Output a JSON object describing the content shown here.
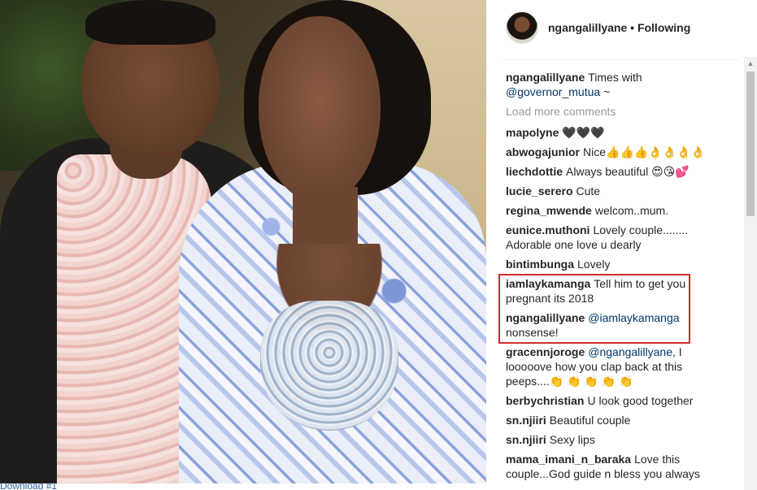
{
  "photo": {
    "caption": "Download #1"
  },
  "header": {
    "username": "ngangalillyane",
    "separator": "•",
    "follow_state": "Following"
  },
  "caption": {
    "username": "ngangalillyane",
    "text_before": "Times with",
    "mention": "@governor_mutua",
    "text_after": "~"
  },
  "load_more": "Load more comments",
  "comments": [
    {
      "username": "mapolyne",
      "text": "🖤🖤🖤"
    },
    {
      "username": "abwogajunior",
      "text": "Nice👍👍👍👌👌👌👌"
    },
    {
      "username": "liechdottie",
      "text": "Always beautiful 😍😘💕"
    },
    {
      "username": "lucie_serero",
      "text": "Cute"
    },
    {
      "username": "regina_mwende",
      "text": "welcom..mum."
    },
    {
      "username": "eunice.muthoni",
      "text": "Lovely couple........ Adorable one love u dearly"
    },
    {
      "username": "bintimbunga",
      "text": "Lovely"
    },
    {
      "username": "iamlaykamanga",
      "text": "Tell him to get you pregnant its 2018"
    },
    {
      "username": "ngangalillyane",
      "mention": "@iamlaykamanga",
      "text": "nonsense!"
    },
    {
      "username": "gracennjoroge",
      "mention": "@ngangalillyane,",
      "text": "I looooove how you clap back at this peeps....👏 👏 👏 👏 👏"
    },
    {
      "username": "berbychristian",
      "text": "U look good together"
    },
    {
      "username": "sn.njiiri",
      "text": "Beautiful couple"
    },
    {
      "username": "sn.njiiri",
      "text": "Sexy lips"
    },
    {
      "username": "mama_imani_n_baraka",
      "text": "Love this couple...God guide n bless you always"
    }
  ],
  "highlight_color": "#d42a2a"
}
